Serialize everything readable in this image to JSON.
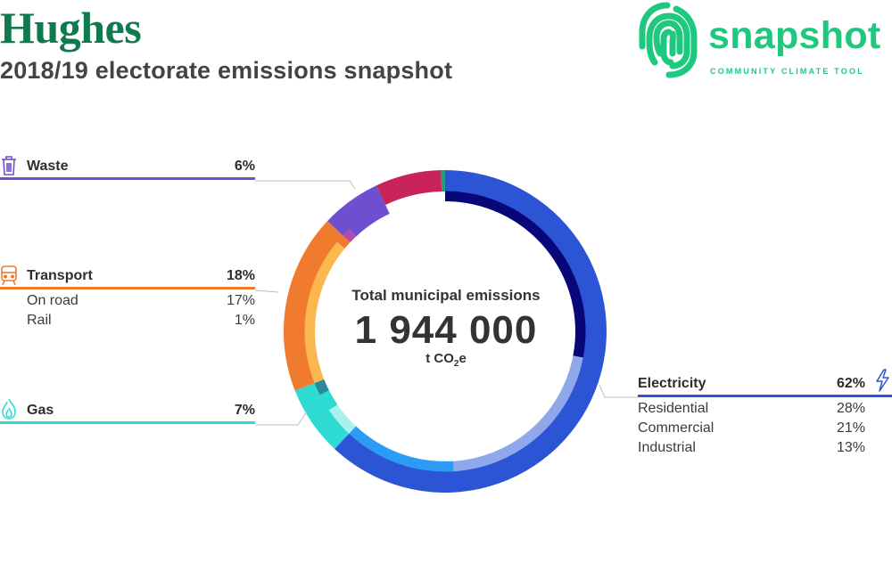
{
  "header": {
    "title": "Hughes",
    "subtitle": "2018/19 electorate emissions snapshot"
  },
  "logo": {
    "wordmark": "snapshot",
    "tagline": "COMMUNITY CLIMATE TOOL",
    "color": "#1ec97f",
    "icon": "fingerprint-swirl-icon"
  },
  "chart_data": {
    "type": "pie",
    "style": "donut",
    "center_label": "Total municipal emissions",
    "total_display": "1 944 000",
    "unit": "t CO₂e",
    "unit_parts": {
      "base": "t CO",
      "sub": "2",
      "tail": "e"
    },
    "categories": [
      {
        "name": "Electricity",
        "percent_label": "62%",
        "value": 62,
        "color": "#2b55d4",
        "icon": "lightning-icon",
        "subcategories": [
          {
            "name": "Residential",
            "percent_label": "28%",
            "value": 28,
            "color": "#07077a"
          },
          {
            "name": "Commercial",
            "percent_label": "21%",
            "value": 21,
            "color": "#8fa8ea"
          },
          {
            "name": "Industrial",
            "percent_label": "13%",
            "value": 13,
            "color": "#2b9bf5"
          }
        ]
      },
      {
        "name": "Gas",
        "percent_label": "7%",
        "value": 7,
        "color": "#2ddbd3",
        "icon": "flame-icon",
        "subcategories": [
          {
            "name": "",
            "value": 3.5,
            "color": "#a9f0ee"
          },
          {
            "name": "",
            "value": 2.0,
            "color": "#2ddbd3"
          },
          {
            "name": "",
            "value": 1.5,
            "color": "#2a8c9a"
          }
        ]
      },
      {
        "name": "Transport",
        "percent_label": "18%",
        "value": 18,
        "color": "#f07a2e",
        "icon": "train-icon",
        "subcategories": [
          {
            "name": "On road",
            "percent_label": "17%",
            "value": 17,
            "color": "#fbb750"
          },
          {
            "name": "Rail",
            "percent_label": "1%",
            "value": 1,
            "color": "#f07a2e"
          }
        ]
      },
      {
        "name": "Waste",
        "percent_label": "6%",
        "value": 6,
        "color": "#6e4fd0",
        "icon": "trash-can-icon",
        "subcategories": [
          {
            "name": "",
            "value": 1,
            "color": "#b44ab0"
          },
          {
            "name": "",
            "value": 5,
            "color": "#6e4fd0"
          }
        ]
      },
      {
        "name": "",
        "value": 6.6,
        "color": "#c8245a",
        "subcategories": []
      },
      {
        "name": "",
        "value": 0.4,
        "color": "#1aa37a",
        "subcategories": []
      }
    ]
  }
}
